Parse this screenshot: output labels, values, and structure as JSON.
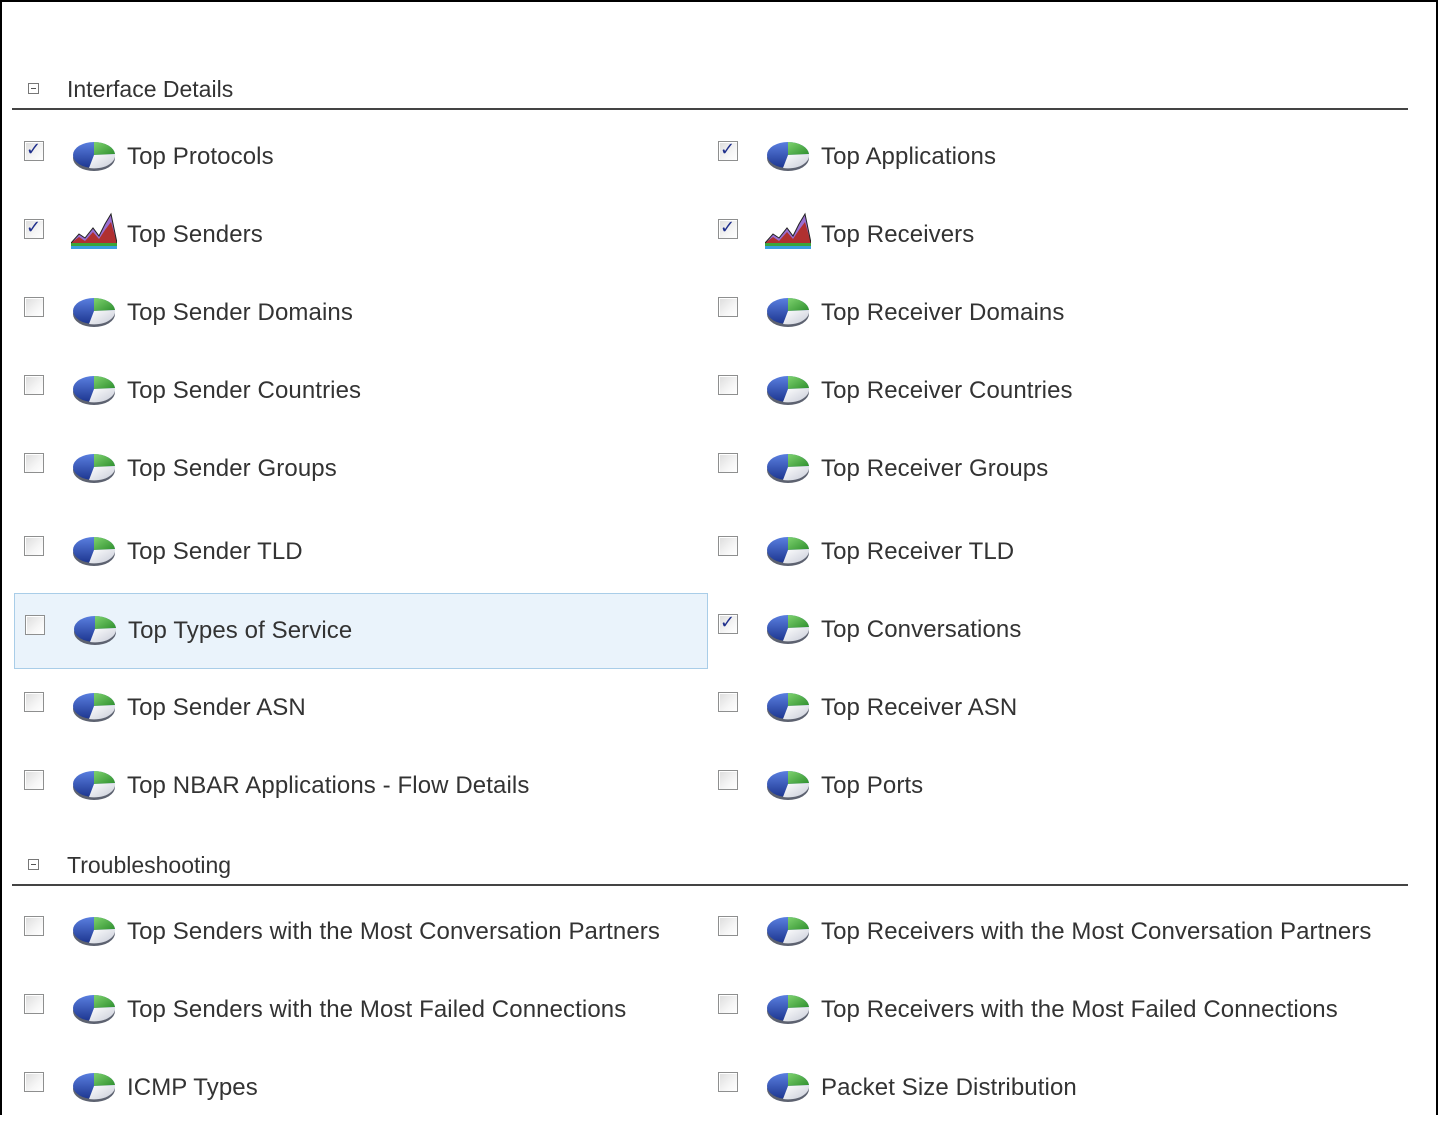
{
  "sections": [
    {
      "title": "Interface Details",
      "items": [
        {
          "left": {
            "label": "Top Protocols",
            "checked": true,
            "icon": "pie-chart-icon"
          },
          "right": {
            "label": "Top Applications",
            "checked": true,
            "icon": "pie-chart-icon"
          }
        },
        {
          "left": {
            "label": "Top Senders",
            "checked": true,
            "icon": "area-chart-icon"
          },
          "right": {
            "label": "Top Receivers",
            "checked": true,
            "icon": "area-chart-icon"
          }
        },
        {
          "left": {
            "label": "Top Sender Domains",
            "checked": false,
            "icon": "pie-chart-icon"
          },
          "right": {
            "label": "Top Receiver Domains",
            "checked": false,
            "icon": "pie-chart-icon"
          }
        },
        {
          "left": {
            "label": "Top Sender Countries",
            "checked": false,
            "icon": "pie-chart-icon"
          },
          "right": {
            "label": "Top Receiver Countries",
            "checked": false,
            "icon": "pie-chart-icon"
          }
        },
        {
          "left": {
            "label": "Top Sender Groups",
            "checked": false,
            "icon": "pie-chart-icon"
          },
          "right": {
            "label": "Top Receiver Groups",
            "checked": false,
            "icon": "pie-chart-icon"
          }
        },
        {
          "left": {
            "label": "Top Sender TLD",
            "checked": false,
            "icon": "pie-chart-icon"
          },
          "right": {
            "label": "Top Receiver TLD",
            "checked": false,
            "icon": "pie-chart-icon"
          }
        },
        {
          "left": {
            "label": "Top Types of Service",
            "checked": false,
            "icon": "pie-chart-icon",
            "highlighted": true
          },
          "right": {
            "label": "Top Conversations",
            "checked": true,
            "icon": "pie-chart-icon"
          }
        },
        {
          "left": {
            "label": "Top Sender ASN",
            "checked": false,
            "icon": "pie-chart-icon"
          },
          "right": {
            "label": "Top Receiver ASN",
            "checked": false,
            "icon": "pie-chart-icon"
          }
        },
        {
          "left": {
            "label": "Top NBAR Applications - Flow Details",
            "checked": false,
            "icon": "pie-chart-icon"
          },
          "right": {
            "label": "Top Ports",
            "checked": false,
            "icon": "pie-chart-icon"
          }
        }
      ]
    },
    {
      "title": "Troubleshooting",
      "items": [
        {
          "left": {
            "label": "Top Senders with the Most Conversation Partners",
            "checked": false,
            "icon": "pie-chart-icon"
          },
          "right": {
            "label": "Top Receivers with the Most Conversation Partners",
            "checked": false,
            "icon": "pie-chart-icon"
          }
        },
        {
          "left": {
            "label": "Top Senders with the Most Failed Connections",
            "checked": false,
            "icon": "pie-chart-icon"
          },
          "right": {
            "label": "Top Receivers with the Most Failed Connections",
            "checked": false,
            "icon": "pie-chart-icon"
          }
        },
        {
          "left": {
            "label": "ICMP Types",
            "checked": false,
            "icon": "pie-chart-icon"
          },
          "right": {
            "label": "Packet Size Distribution",
            "checked": false,
            "icon": "pie-chart-icon"
          }
        }
      ]
    }
  ],
  "colors": {
    "checkmark": "#1f2f8c",
    "highlight_bg": "#eaf3fb",
    "highlight_border": "#a9cde8",
    "pie_green": "#3aa63a",
    "pie_blue": "#2c4fb8",
    "area_purple": "#9a6fd0",
    "area_red": "#b03030"
  }
}
